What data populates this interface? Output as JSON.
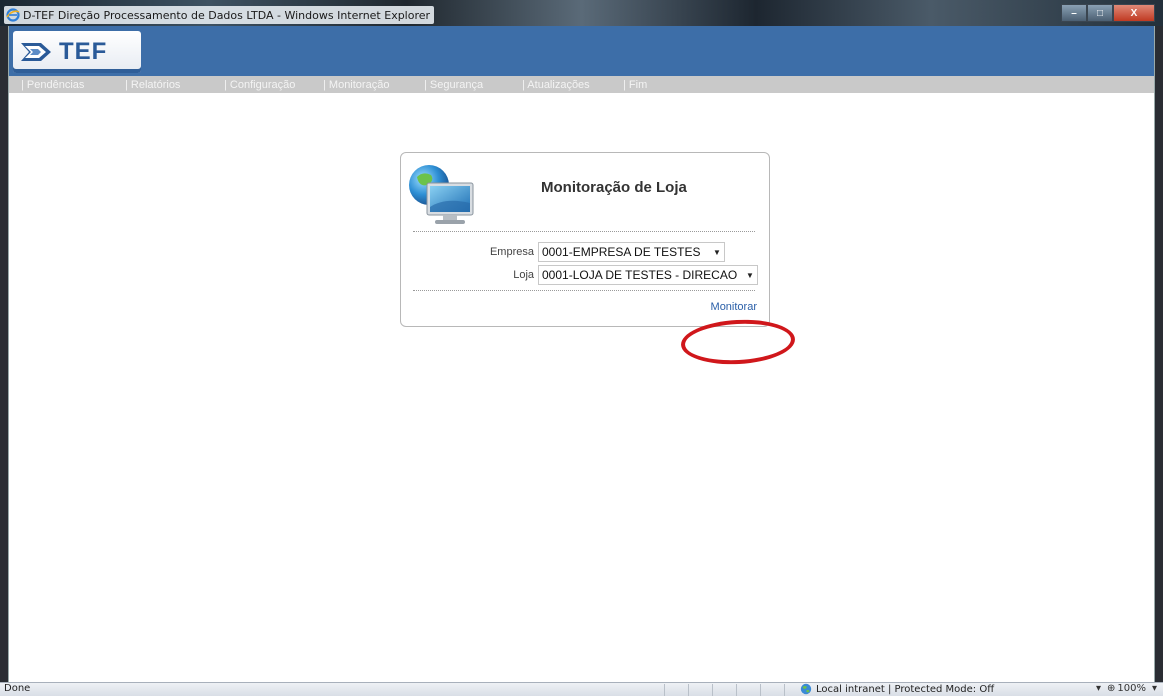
{
  "window": {
    "title": "D-TEF Direção Processamento de Dados LTDA - Windows Internet Explorer",
    "controls": {
      "minimize": "–",
      "maximize": "□",
      "close": "X"
    }
  },
  "app": {
    "logo_text": "TEF",
    "header_color": "#3d6ea8"
  },
  "menu": {
    "items": [
      {
        "label": "| Pendências"
      },
      {
        "label": "| Relatórios"
      },
      {
        "label": "| Configuração"
      },
      {
        "label": "| Monitoração"
      },
      {
        "label": "| Segurança"
      },
      {
        "label": "| Atualizações"
      },
      {
        "label": "| Fim"
      }
    ]
  },
  "card": {
    "icon": "monitor-globe-icon",
    "title": "Monitoração de Loja",
    "empresa": {
      "label": "Empresa",
      "value": "0001-EMPRESA DE TESTES"
    },
    "loja": {
      "label": "Loja",
      "value": "0001-LOJA DE TESTES - DIRECAO"
    },
    "action_label": "Monitorar",
    "highlight_color": "#d0171b"
  },
  "status": {
    "left": "Done",
    "zone": "Local intranet | Protected Mode: Off",
    "zoom": "100%",
    "zoom_icon": "zoom-icon"
  }
}
